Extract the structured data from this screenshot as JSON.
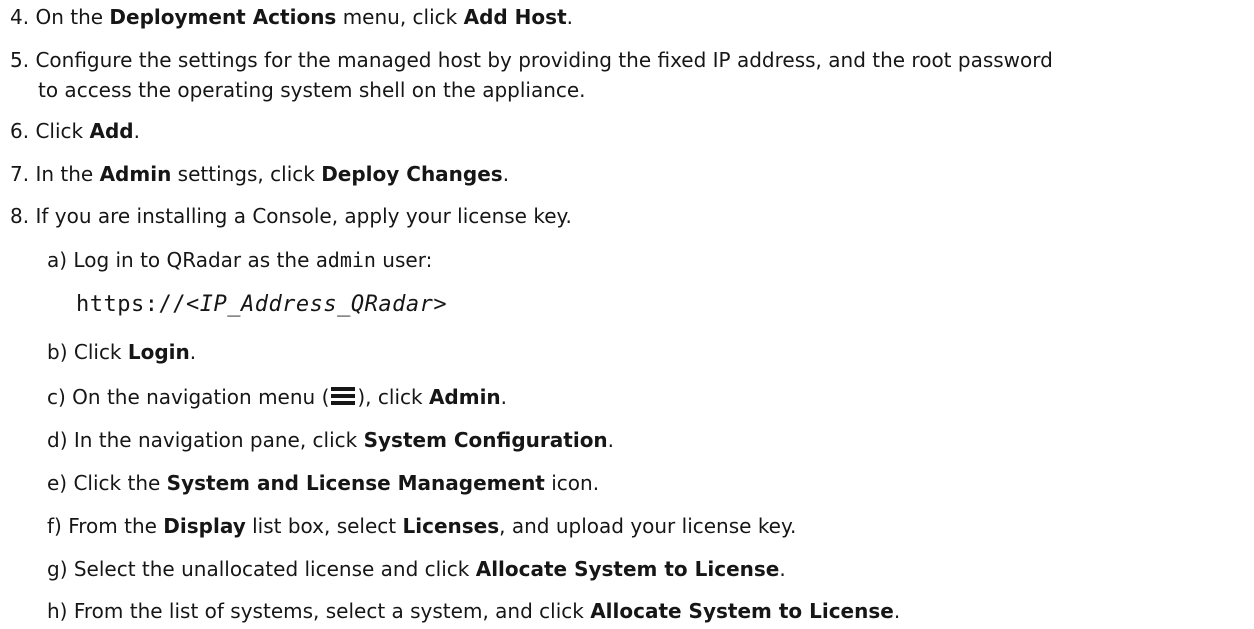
{
  "steps": {
    "s4": {
      "num": "4.",
      "pre": "On the ",
      "b1": "Deployment Actions",
      "mid": " menu, click ",
      "b2": "Add Host",
      "post": "."
    },
    "s5": {
      "num": "5.",
      "line1": "Configure the settings for the managed host by providing the fixed IP address, and the root password",
      "line2": "to access the operating system shell on the appliance."
    },
    "s6": {
      "num": "6.",
      "pre": "Click ",
      "b1": "Add",
      "post": "."
    },
    "s7": {
      "num": "7.",
      "pre": "In the ",
      "b1": "Admin",
      "mid": " settings, click ",
      "b2": "Deploy Changes",
      "post": "."
    },
    "s8": {
      "num": "8.",
      "text": "If you are installing a Console, apply your license key."
    }
  },
  "substeps": {
    "a": {
      "letter": "a)",
      "pre": "Log in to QRadar as the ",
      "code": "admin",
      "post": " user:"
    },
    "url": {
      "prefix": "https://",
      "var": "<IP_Address_QRadar>"
    },
    "b": {
      "letter": "b)",
      "pre": "Click ",
      "b1": "Login",
      "post": "."
    },
    "c": {
      "letter": "c)",
      "pre": "On the navigation menu (",
      "icon": "hamburger-menu-icon",
      "mid": "), click ",
      "b1": "Admin",
      "post": "."
    },
    "d": {
      "letter": "d)",
      "pre": "In the navigation pane, click ",
      "b1": "System Configuration",
      "post": "."
    },
    "e": {
      "letter": "e)",
      "pre": "Click the ",
      "b1": "System and License Management",
      "post": " icon."
    },
    "f": {
      "letter": "f)",
      "pre": "From the ",
      "b1": "Display",
      "mid": " list box, select ",
      "b2": "Licenses",
      "post": ", and upload your license key."
    },
    "g": {
      "letter": "g)",
      "pre": "Select the unallocated license and click ",
      "b1": "Allocate System to License",
      "post": "."
    },
    "h": {
      "letter": "h)",
      "pre": "From the list of systems, select a system, and click ",
      "b1": "Allocate System to License",
      "post": "."
    }
  }
}
